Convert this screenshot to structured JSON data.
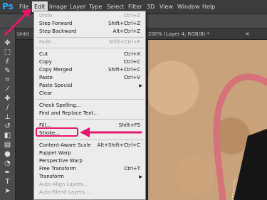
{
  "app": {
    "logo": "Ps"
  },
  "menubar": {
    "items": [
      "File",
      "Edit",
      "Image",
      "Layer",
      "Type",
      "Select",
      "Filter",
      "3D",
      "View",
      "Window",
      "Help"
    ],
    "active": "Edit"
  },
  "doc_tabs": {
    "left_label": "Untit",
    "right_label": "200% (Layer 4, RGB/8) *",
    "close": "×"
  },
  "tools": [
    "move-icon",
    "marquee-icon",
    "lasso-icon",
    "quick-select-icon",
    "crop-icon",
    "eyedropper-icon",
    "healing-icon",
    "brush-icon",
    "clone-stamp-icon",
    "history-brush-icon",
    "eraser-icon",
    "gradient-icon",
    "blur-icon",
    "dodge-icon",
    "pen-icon",
    "type-icon",
    "path-select-icon",
    "shape-icon"
  ],
  "edit_menu": {
    "items": [
      {
        "label": "Undo",
        "shortcut": "Ctrl+Z",
        "disabled": true
      },
      {
        "label": "Step Forward",
        "shortcut": "Shift+Ctrl+Z",
        "disabled": false
      },
      {
        "label": "Step Backward",
        "shortcut": "Alt+Ctrl+Z",
        "disabled": false
      },
      {
        "label": "Fade...",
        "shortcut": "Shift+Ctrl+F",
        "disabled": true
      },
      {
        "label": "Cut",
        "shortcut": "Ctrl+X",
        "disabled": false
      },
      {
        "label": "Copy",
        "shortcut": "Ctrl+C",
        "disabled": false
      },
      {
        "label": "Copy Merged",
        "shortcut": "Shift+Ctrl+C",
        "disabled": false
      },
      {
        "label": "Paste",
        "shortcut": "Ctrl+V",
        "disabled": false
      },
      {
        "label": "Paste Special",
        "shortcut": "",
        "disabled": false,
        "submenu": true
      },
      {
        "label": "Clear",
        "shortcut": "",
        "disabled": false
      },
      {
        "label": "Check Spelling...",
        "shortcut": "",
        "disabled": false
      },
      {
        "label": "Find and Replace Text...",
        "shortcut": "",
        "disabled": false
      },
      {
        "label": "Fill...",
        "shortcut": "Shift+F5",
        "disabled": false
      },
      {
        "label": "Stroke...",
        "shortcut": "",
        "disabled": false
      },
      {
        "label": "Content-Aware Scale",
        "shortcut": "Alt+Shift+Ctrl+C",
        "disabled": false
      },
      {
        "label": "Puppet Warp",
        "shortcut": "",
        "disabled": false
      },
      {
        "label": "Perspective Warp",
        "shortcut": "",
        "disabled": false
      },
      {
        "label": "Free Transform",
        "shortcut": "Ctrl+T",
        "disabled": false
      },
      {
        "label": "Transform",
        "shortcut": "",
        "disabled": false,
        "submenu": true
      },
      {
        "label": "Auto-Align Layers...",
        "shortcut": "",
        "disabled": true
      },
      {
        "label": "Auto-Blend Layers...",
        "shortcut": "",
        "disabled": true
      }
    ]
  },
  "annotation": {
    "color": "#e5196a",
    "highlighted_item": "Stroke..."
  }
}
